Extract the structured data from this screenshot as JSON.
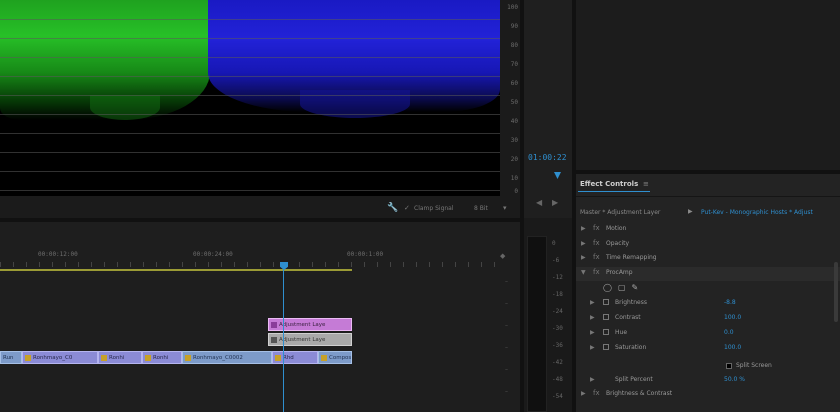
{
  "scope": {
    "axis_labels": [
      "100",
      "90",
      "80",
      "70",
      "60",
      "50",
      "40",
      "30",
      "20",
      "10",
      "0"
    ],
    "clamp_label": "Clamp Signal",
    "bit_depth": "8 Bit",
    "icons": [
      "wrench-icon",
      "menu-icon"
    ]
  },
  "monitor": {
    "timecode": "01:00:22"
  },
  "effect_controls": {
    "tab_label": "Effect Controls",
    "tab_menu": "≡",
    "source_label": "Master * Adjustment Layer",
    "sequence_label": "Put-Kev - Monographic Hosts * Adjust",
    "effects": [
      {
        "label": "Motion",
        "expanded": false
      },
      {
        "label": "Opacity",
        "expanded": false
      },
      {
        "label": "Time Remapping",
        "expanded": false
      },
      {
        "label": "ProcAmp",
        "expanded": true
      }
    ],
    "params": [
      {
        "label": "Brightness",
        "value": "-8.8"
      },
      {
        "label": "Contrast",
        "value": "100.0"
      },
      {
        "label": "Hue",
        "value": "0.0"
      },
      {
        "label": "Saturation",
        "value": "100.0"
      }
    ],
    "split_screen_label": "Split Screen",
    "split_percent_label": "Split Percent",
    "split_percent_value": "50.0 %",
    "brightness_contrast_label": "Brightness & Contrast"
  },
  "timeline": {
    "ruler_timecodes": [
      "00:00:12:00",
      "00:00:24:00",
      "00:00:1:00"
    ],
    "clips": {
      "adjustment_a": "Adjustment Laye",
      "adjustment_b": "Adjustment Laye",
      "v1": [
        "Run",
        "Ronhmayo_C0",
        "Ronhi",
        "Ronhi",
        "Ronhmayo_C0002",
        "Rhd",
        "Compos"
      ]
    },
    "meter_scale": [
      "0",
      "-6",
      "-12",
      "-18",
      "-24",
      "-30",
      "-36",
      "-42",
      "-48",
      "-54"
    ]
  }
}
